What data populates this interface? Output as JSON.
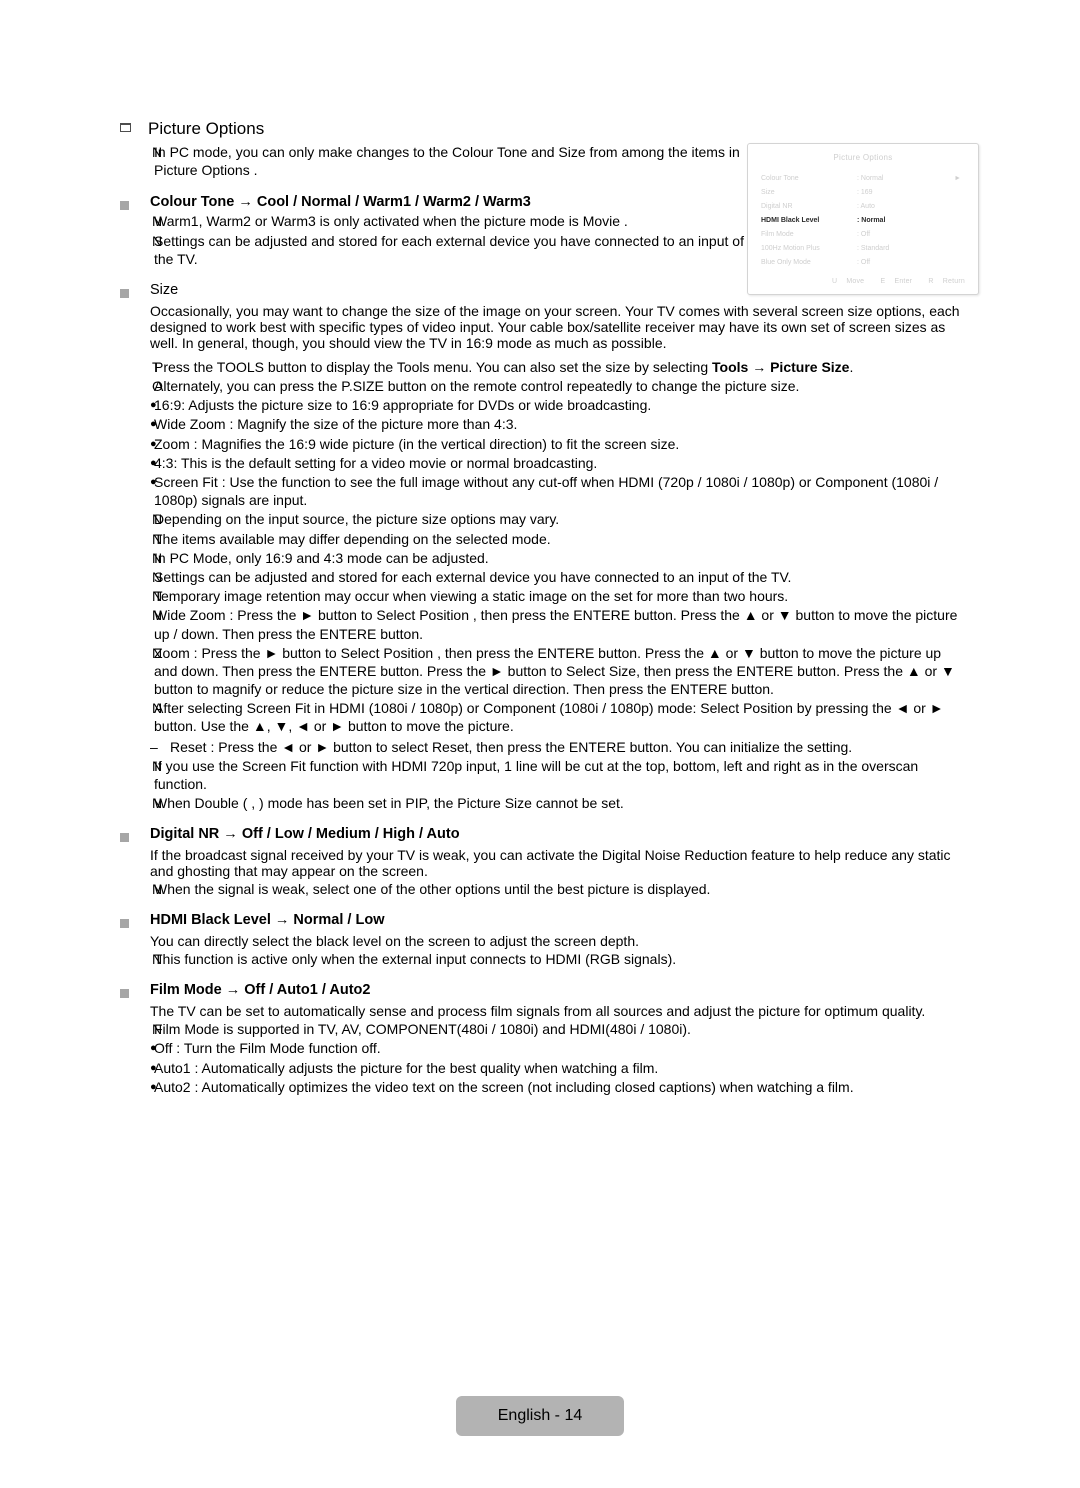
{
  "chapter": {
    "title": "Picture Options",
    "icon": "checkbox-outline-icon",
    "intro_note": "In PC mode, you can only make changes to the Colour Tone  and Size from among the items in Picture Options ."
  },
  "sections": {
    "colour_tone": {
      "heading": "Colour Tone → Cool / Normal / Warm1 / Warm2 / Warm3",
      "notes": [
        "Warm1, Warm2  or Warm3  is only activated when the picture mode is Movie .",
        "Settings can be adjusted and stored for each external device you have connected to an input of the TV."
      ]
    },
    "size": {
      "heading": "Size",
      "paragraph": "Occasionally, you may want to change the size of the image on your screen. Your TV comes with several screen size options, each designed to work best with specific types of video input. Your cable box/satellite receiver may have its own set of screen sizes as well. In general, though, you should view the TV in 16:9 mode as much as possible.",
      "tool_line_marker": "T",
      "tool_line_pre": "Press the TOOLS button to display the Tools  menu. You can also set the size by selecting ",
      "tool_line_bold": "Tools → Picture Size",
      "tool_line_post": ".",
      "alt_line_marker": "O",
      "alt_line": "Alternately, you can press the P.SIZE button on the remote control repeatedly to change the picture size.",
      "bullets": [
        "16:9: Adjusts the picture size to 16:9 appropriate for DVDs or wide broadcasting.",
        "Wide Zoom : Magnify the size of the picture more than 4:3.",
        "Zoom : Magnifies the 16:9 wide picture (in the vertical direction) to fit the screen size.",
        "4:3: This is the default setting for a video movie or normal broadcasting.",
        "Screen Fit : Use the function to see the full image without any cut-off when HDMI (720p / 1080i / 1080p) or Component (1080i / 1080p) signals are input."
      ],
      "notes": [
        "Depending on the input source, the picture size options may vary.",
        "The items available may differ depending on the selected mode.",
        "In PC Mode, only 16:9 and 4:3 mode can be adjusted.",
        "Settings can be adjusted and stored for each external device you have connected to an input of the TV.",
        "Temporary image retention may occur when viewing a static image on the set for more than two hours."
      ],
      "note_wide_zoom": "Wide Zoom : Press the ► button to Select Position , then press the ENTERE   button. Press the ▲ or ▼ button to move the picture up / down. Then press the ENTERE   button.",
      "note_zoom": "Zoom : Press the ► button to Select Position , then press the ENTERE   button. Press the ▲ or ▼ button to move the picture up and down. Then press the ENTERE   button. Press the ► button to Select Size, then press the ENTERE button. Press the ▲ or ▼ button to magnify or reduce the picture size in the vertical direction. Then press the ENTERE button.",
      "note_screen_fit": "After selecting Screen Fit  in HDMI (1080i / 1080p) or Component (1080i / 1080p) mode: Select Position  by pressing the ◄ or ► button. Use the ▲, ▼, ◄ or ► button to move the picture.",
      "reset_dash": "–",
      "reset_line": "Reset : Press the ◄ or ► button to select Reset, then press the ENTERE   button. You can initialize the setting.",
      "note_720p": "If you use the Screen Fit  function with HDMI 720p input, 1 line will be cut at the top, bottom, left and right as in the overscan function.",
      "note_double": "When Double (   ,     ) mode has been set in PIP, the Picture Size cannot be set."
    },
    "digital_nr": {
      "heading": "Digital NR → Off / Low / Medium / High / Auto",
      "paragraph": "If the broadcast signal received by your TV is weak, you can activate the Digital Noise Reduction feature to help reduce any static and ghosting that may appear on the screen.",
      "notes": [
        "When the signal is weak, select one of the other options until the best picture is displayed."
      ]
    },
    "hdmi_black_level": {
      "heading": "HDMI Black Level → Normal / Low",
      "paragraph": "You can directly select the black level on the screen to adjust the screen depth.",
      "notes": [
        "This function is active only when the external input connects to HDMI (RGB signals)."
      ]
    },
    "film_mode": {
      "heading": "Film Mode → Off / Auto1 / Auto2",
      "paragraph": "The TV can be set to automatically sense and process film signals from all sources and adjust the picture for optimum quality.",
      "notes": [
        "Film Mode  is supported in TV, AV, COMPONENT(480i / 1080i) and HDMI(480i / 1080i)."
      ],
      "bullets": [
        "Off : Turn the Film Mode function off.",
        "Auto1 : Automatically adjusts the picture for the best quality when watching a film.",
        "Auto2 : Automatically optimizes the video text on the screen (not including closed captions) when watching a film."
      ]
    }
  },
  "osd": {
    "title": "Picture Options",
    "arrow": "►",
    "items": [
      {
        "label": "Colour Tone",
        "value": ": Normal",
        "arrow": "►",
        "selected": false
      },
      {
        "label": "Size",
        "value": ": 169",
        "arrow": "",
        "selected": false
      },
      {
        "label": "Digital NR",
        "value": ": Auto",
        "arrow": "",
        "selected": false
      },
      {
        "label": "HDMI Black Level",
        "value": ": Normal",
        "arrow": "",
        "selected": true
      },
      {
        "label": "Film Mode",
        "value": ": Off",
        "arrow": "",
        "selected": false
      },
      {
        "label": "100Hz Motion Plus",
        "value": ": Standard",
        "arrow": "",
        "selected": false
      },
      {
        "label": "Blue Only Mode",
        "value": ": Off",
        "arrow": "",
        "selected": false
      }
    ],
    "footer": [
      {
        "key": "U",
        "action": "Move"
      },
      {
        "key": "E",
        "action": "Enter"
      },
      {
        "key": "R",
        "action": "Return"
      }
    ]
  },
  "footer": {
    "page_label": "English - 14"
  },
  "markers": {
    "note": "N",
    "bullet": "●",
    "tools": "T",
    "alternate": "O"
  }
}
